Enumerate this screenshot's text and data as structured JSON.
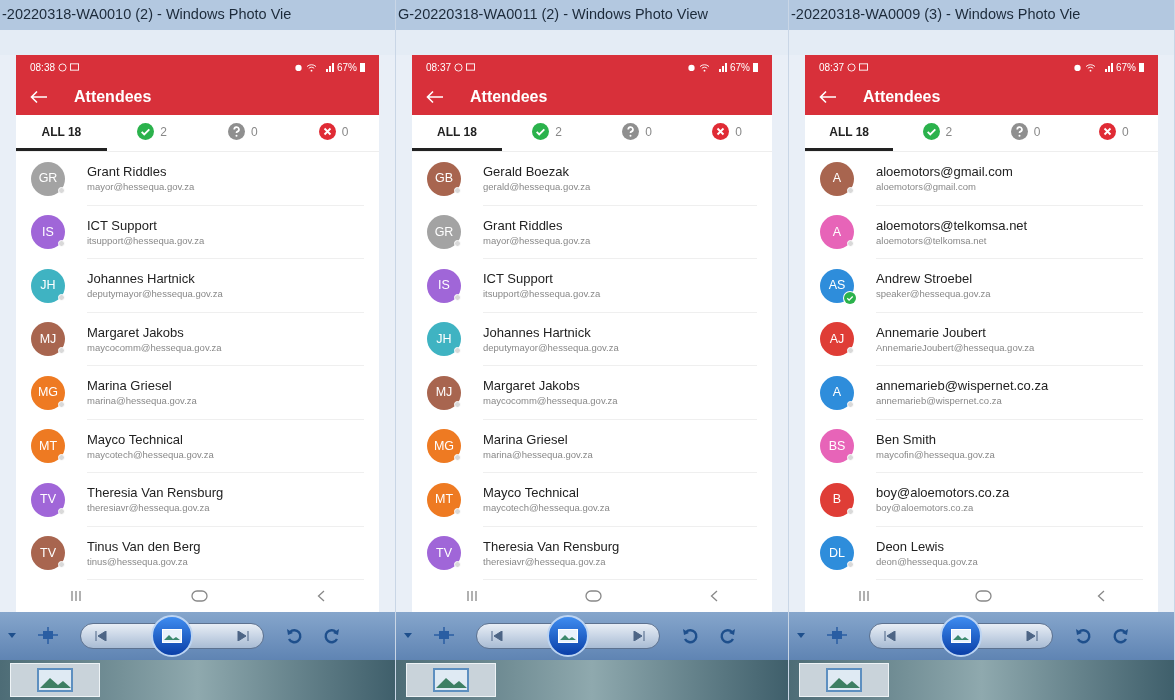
{
  "panels": [
    {
      "window_title": "-20220318-WA0010 (2) - Windows Photo Vie",
      "status_time": "08:38",
      "battery": "67%",
      "header_title": "Attendees",
      "tabs": [
        {
          "kind": "all",
          "label": "ALL 18",
          "selected": true
        },
        {
          "kind": "accepted",
          "label": "2",
          "selected": false
        },
        {
          "kind": "tentative",
          "label": "0",
          "selected": false
        },
        {
          "kind": "declined",
          "label": "0",
          "selected": false
        }
      ],
      "attendees": [
        {
          "initials": "GR",
          "name": "Grant Riddles",
          "email": "mayor@hessequa.gov.za",
          "color": "#a3a3a3",
          "accepted": false
        },
        {
          "initials": "IS",
          "name": "ICT Support",
          "email": "itsupport@hessequa.gov.za",
          "color": "#a066d8",
          "accepted": false
        },
        {
          "initials": "JH",
          "name": "Johannes Hartnick",
          "email": "deputymayor@hessequa.gov.za",
          "color": "#3fb3c2",
          "accepted": false
        },
        {
          "initials": "MJ",
          "name": "Margaret Jakobs",
          "email": "maycocomm@hessequa.gov.za",
          "color": "#a8654f",
          "accepted": false
        },
        {
          "initials": "MG",
          "name": "Marina Griesel",
          "email": "marina@hessequa.gov.za",
          "color": "#ee7a22",
          "accepted": false
        },
        {
          "initials": "MT",
          "name": "Mayco Technical",
          "email": "maycotech@hessequa.gov.za",
          "color": "#ee7a22",
          "accepted": false
        },
        {
          "initials": "TV",
          "name": "Theresia Van Rensburg",
          "email": "theresiavr@hessequa.gov.za",
          "color": "#a066d8",
          "accepted": false
        },
        {
          "initials": "TV",
          "name": "Tinus Van den Berg",
          "email": "tinus@hessequa.gov.za",
          "color": "#a8654f",
          "accepted": false
        }
      ]
    },
    {
      "window_title": "G-20220318-WA0011 (2) - Windows Photo View",
      "status_time": "08:37",
      "battery": "67%",
      "header_title": "Attendees",
      "tabs": [
        {
          "kind": "all",
          "label": "ALL 18",
          "selected": true
        },
        {
          "kind": "accepted",
          "label": "2",
          "selected": false
        },
        {
          "kind": "tentative",
          "label": "0",
          "selected": false
        },
        {
          "kind": "declined",
          "label": "0",
          "selected": false
        }
      ],
      "attendees": [
        {
          "initials": "GB",
          "name": "Gerald Boezak",
          "email": "gerald@hessequa.gov.za",
          "color": "#a8654f",
          "accepted": false
        },
        {
          "initials": "GR",
          "name": "Grant Riddles",
          "email": "mayor@hessequa.gov.za",
          "color": "#a3a3a3",
          "accepted": false
        },
        {
          "initials": "IS",
          "name": "ICT Support",
          "email": "itsupport@hessequa.gov.za",
          "color": "#a066d8",
          "accepted": false
        },
        {
          "initials": "JH",
          "name": "Johannes Hartnick",
          "email": "deputymayor@hessequa.gov.za",
          "color": "#3fb3c2",
          "accepted": false
        },
        {
          "initials": "MJ",
          "name": "Margaret Jakobs",
          "email": "maycocomm@hessequa.gov.za",
          "color": "#a8654f",
          "accepted": false
        },
        {
          "initials": "MG",
          "name": "Marina Griesel",
          "email": "marina@hessequa.gov.za",
          "color": "#ee7a22",
          "accepted": false
        },
        {
          "initials": "MT",
          "name": "Mayco Technical",
          "email": "maycotech@hessequa.gov.za",
          "color": "#ee7a22",
          "accepted": false
        },
        {
          "initials": "TV",
          "name": "Theresia Van Rensburg",
          "email": "theresiavr@hessequa.gov.za",
          "color": "#a066d8",
          "accepted": false
        }
      ]
    },
    {
      "window_title": "-20220318-WA0009 (3) - Windows Photo Vie",
      "status_time": "08:37",
      "battery": "67%",
      "header_title": "Attendees",
      "tabs": [
        {
          "kind": "all",
          "label": "ALL 18",
          "selected": true
        },
        {
          "kind": "accepted",
          "label": "2",
          "selected": false
        },
        {
          "kind": "tentative",
          "label": "0",
          "selected": false
        },
        {
          "kind": "declined",
          "label": "0",
          "selected": false
        }
      ],
      "attendees": [
        {
          "initials": "A",
          "name": "aloemotors@gmail.com",
          "email": "aloemotors@gmail.com",
          "color": "#a8654f",
          "accepted": false
        },
        {
          "initials": "A",
          "name": "aloemotors@telkomsa.net",
          "email": "aloemotors@telkomsa.net",
          "color": "#e764b8",
          "accepted": false
        },
        {
          "initials": "AS",
          "name": "Andrew Stroebel",
          "email": "speaker@hessequa.gov.za",
          "color": "#2e8ddb",
          "accepted": true
        },
        {
          "initials": "AJ",
          "name": "Annemarie Joubert",
          "email": "AnnemarieJoubert@hessequa.gov.za",
          "color": "#df3d36",
          "accepted": false
        },
        {
          "initials": "A",
          "name": "annemarieb@wispernet.co.za",
          "email": "annemarieb@wispernet.co.za",
          "color": "#2e8ddb",
          "accepted": false
        },
        {
          "initials": "BS",
          "name": "Ben Smith",
          "email": "maycofin@hessequa.gov.za",
          "color": "#e764b8",
          "accepted": false
        },
        {
          "initials": "B",
          "name": "boy@aloemotors.co.za",
          "email": "boy@aloemotors.co.za",
          "color": "#df3d36",
          "accepted": false
        },
        {
          "initials": "DL",
          "name": "Deon Lewis",
          "email": "deon@hessequa.gov.za",
          "color": "#2e8ddb",
          "accepted": false
        }
      ]
    }
  ]
}
